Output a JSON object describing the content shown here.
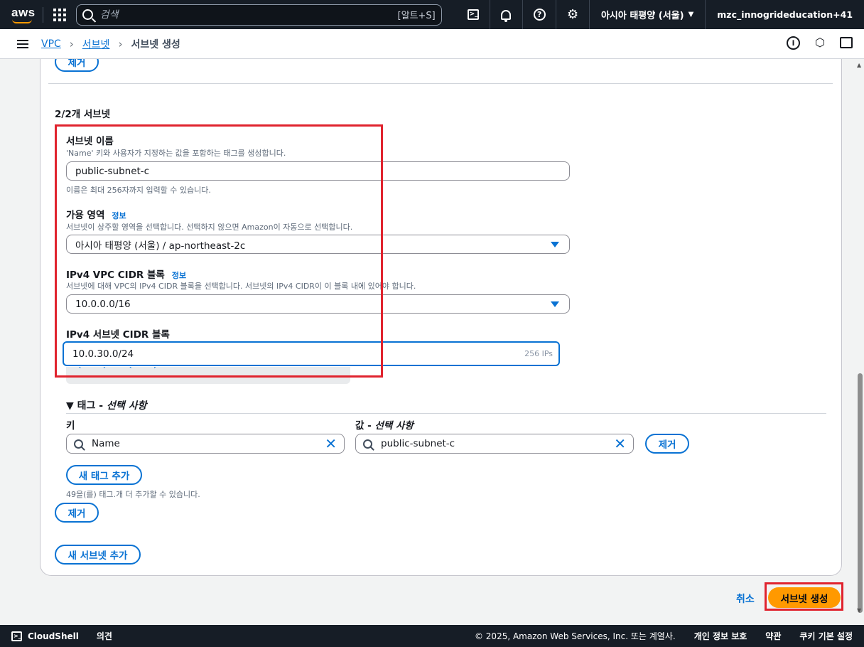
{
  "topnav": {
    "logo": "aws",
    "search_placeholder": "검색",
    "search_shortcut": "[알트+S]",
    "region": "아시아 태평양 (서울)",
    "account": "mzc_innogrideducation+41"
  },
  "breadcrumb": {
    "items": [
      "VPC",
      "서브넷"
    ],
    "current": "서브넷 생성"
  },
  "form": {
    "remove_top_label": "제거",
    "section_title": "2/2개 서브넷",
    "subnet_name": {
      "label": "서브넷 이름",
      "description": "'Name' 키와 사용자가 지정하는 값을 포함하는 태그를 생성합니다.",
      "value": "public-subnet-c",
      "hint": "이름은 최대 256자까지 입력할 수 있습니다."
    },
    "az": {
      "label": "가용 영역",
      "info": "정보",
      "description": "서브넷이 상주할 영역을 선택합니다. 선택하지 않으면 Amazon이 자동으로 선택합니다.",
      "value": "아시아 태평양 (서울) / ap-northeast-2c"
    },
    "vpc_cidr": {
      "label": "IPv4 VPC CIDR 블록",
      "info": "정보",
      "description": "서브넷에 대해 VPC의 IPv4 CIDR 블록을 선택합니다. 서브넷의 IPv4 CIDR이 이 블록 내에 있어야 합니다.",
      "value": "10.0.0.0/16"
    },
    "subnet_cidr": {
      "label": "IPv4 서브넷 CIDR 블록",
      "value": "10.0.30.0/24",
      "ips": "256 IPs"
    },
    "tags": {
      "title_main": "▼ 태그 - ",
      "title_optional": "선택 사항",
      "key_label": "키",
      "value_label_main": "값 - ",
      "value_label_optional": "선택 사항",
      "key_value": "Name",
      "value_value": "public-subnet-c",
      "remove_label": "제거",
      "add_label": "새 태그 추가",
      "note": "49을(를) 태그.개 더 추가할 수 있습니다."
    },
    "remove_subnet_label": "제거",
    "add_subnet_label": "새 서브넷 추가"
  },
  "actions": {
    "cancel": "취소",
    "create": "서브넷 생성"
  },
  "footer": {
    "cloudshell": "CloudShell",
    "feedback": "의견",
    "copyright": "© 2025, Amazon Web Services, Inc. 또는 계열사.",
    "privacy": "개인 정보 보호",
    "terms": "약관",
    "cookies": "쿠키 기본 설정"
  },
  "colors": {
    "accent": "#0972d3",
    "primary_button": "#ff9900",
    "highlight": "#e0232e",
    "nav_bg": "#161d26"
  }
}
